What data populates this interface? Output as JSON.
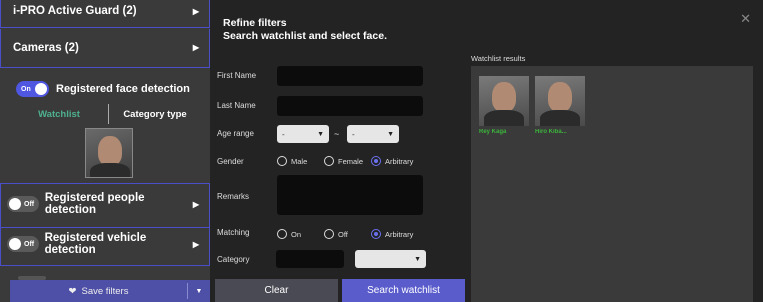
{
  "sidebar": {
    "active_guard": "i-PRO Active Guard (2)",
    "cameras": "Cameras (2)",
    "face_detection": {
      "toggle": "On",
      "label": "Registered face detection",
      "tab_watchlist": "Watchlist",
      "tab_category": "Category type"
    },
    "people_detection": {
      "toggle": "Off",
      "label": "Registered people detection"
    },
    "vehicle_detection": {
      "toggle": "Off",
      "label": "Registered vehicle detection"
    },
    "save_filters": "Save filters"
  },
  "panel": {
    "title": "Refine filters",
    "subtitle": "Search watchlist and select face.",
    "fields": {
      "first_name": "First Name",
      "last_name": "Last Name",
      "age_range": "Age range",
      "age_from": "-",
      "age_to": "-",
      "age_sep": "~",
      "gender": "Gender",
      "gender_options": [
        "Male",
        "Female",
        "Arbitrary"
      ],
      "gender_selected": "Arbitrary",
      "remarks": "Remarks",
      "matching": "Matching",
      "matching_options": [
        "On",
        "Off",
        "Arbitrary"
      ],
      "matching_selected": "Arbitrary",
      "category": "Category"
    },
    "clear_label": "Clear",
    "search_label": "Search watchlist"
  },
  "results": {
    "label": "Watchlist results",
    "items": [
      {
        "name": "Rey Kaga"
      },
      {
        "name": "Hiro Kiba..."
      }
    ]
  },
  "colors": {
    "accent": "#5a5ccc",
    "toggle_on": "#4f56e0",
    "result_name": "#3cb43c",
    "watchlist_tab": "#4fb090"
  }
}
